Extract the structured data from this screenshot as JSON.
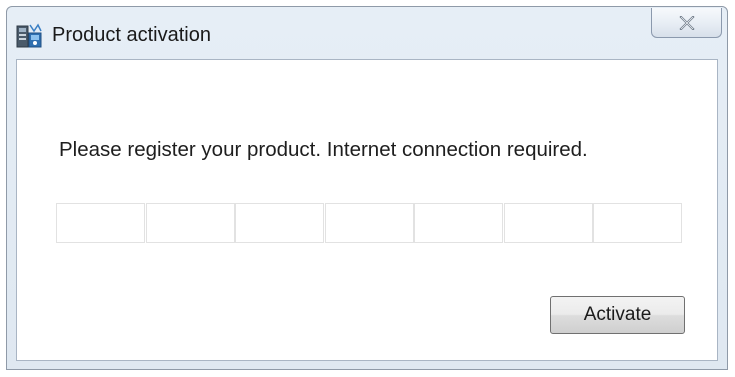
{
  "window": {
    "title": "Product activation",
    "app_icon": "app-icon",
    "close_icon": "close-x-icon"
  },
  "main": {
    "prompt": "Please register your product. Internet connection required.",
    "key_fields": [
      {
        "value": ""
      },
      {
        "value": ""
      },
      {
        "value": ""
      },
      {
        "value": ""
      },
      {
        "value": ""
      },
      {
        "value": ""
      },
      {
        "value": ""
      }
    ],
    "activate_label": "Activate"
  },
  "colors": {
    "frame": "#dfe8f1",
    "client_background": "#ffffff",
    "field_border": "#e2e2e2"
  }
}
